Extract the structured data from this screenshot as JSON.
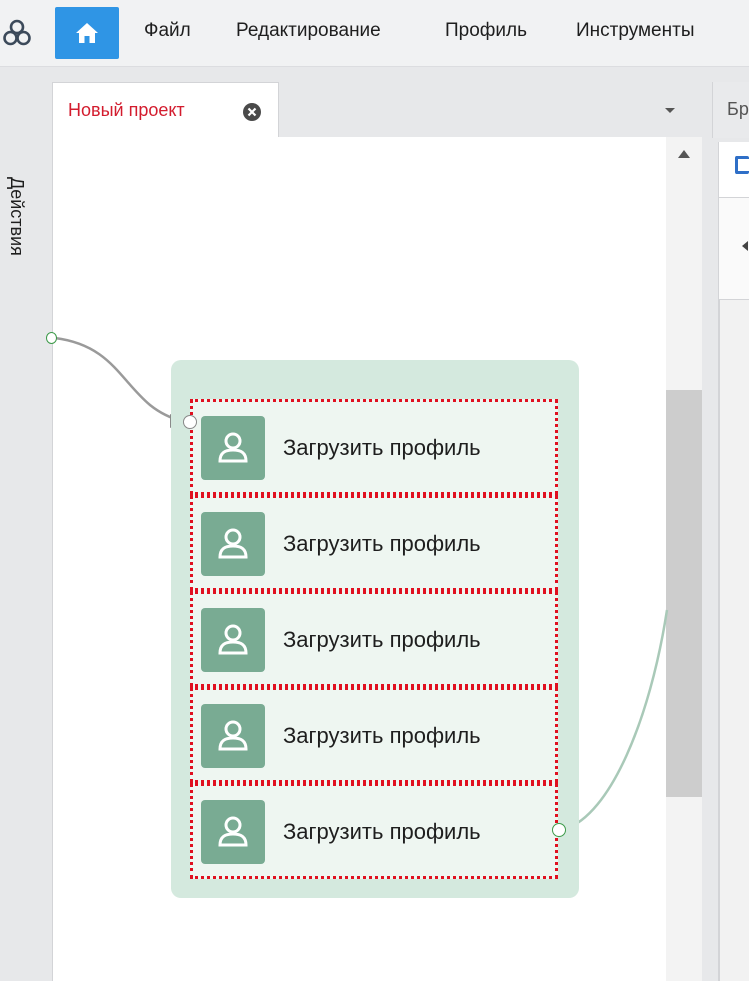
{
  "menubar": {
    "logo_icon": "app-logo-icon",
    "home_icon": "home-icon",
    "items": [
      {
        "label": "Файл"
      },
      {
        "label": "Редактирование"
      },
      {
        "label": "Профиль"
      },
      {
        "label": "Инструменты"
      }
    ]
  },
  "left_strip": {
    "label": "Действия"
  },
  "tabs": {
    "active": {
      "title": "Новый проект",
      "close_icon": "close-circle-icon"
    },
    "dropdown_icon": "caret-down-icon"
  },
  "canvas": {
    "group": {
      "actions": [
        {
          "label": "Загрузить профиль",
          "icon": "user-profile-icon"
        },
        {
          "label": "Загрузить профиль",
          "icon": "user-profile-icon"
        },
        {
          "label": "Загрузить профиль",
          "icon": "user-profile-icon"
        },
        {
          "label": "Загрузить профиль",
          "icon": "user-profile-icon"
        },
        {
          "label": "Загрузить профиль",
          "icon": "user-profile-icon"
        }
      ]
    },
    "colors": {
      "group_bg": "#d4e9de",
      "action_bg": "#eef6f1",
      "selection_border": "#e01020",
      "icon_bg": "#79ab93"
    }
  },
  "right_panel": {
    "tab_label": "Бр"
  },
  "colors": {
    "accent": "#2f95e5",
    "tab_title": "#d31c2e"
  }
}
